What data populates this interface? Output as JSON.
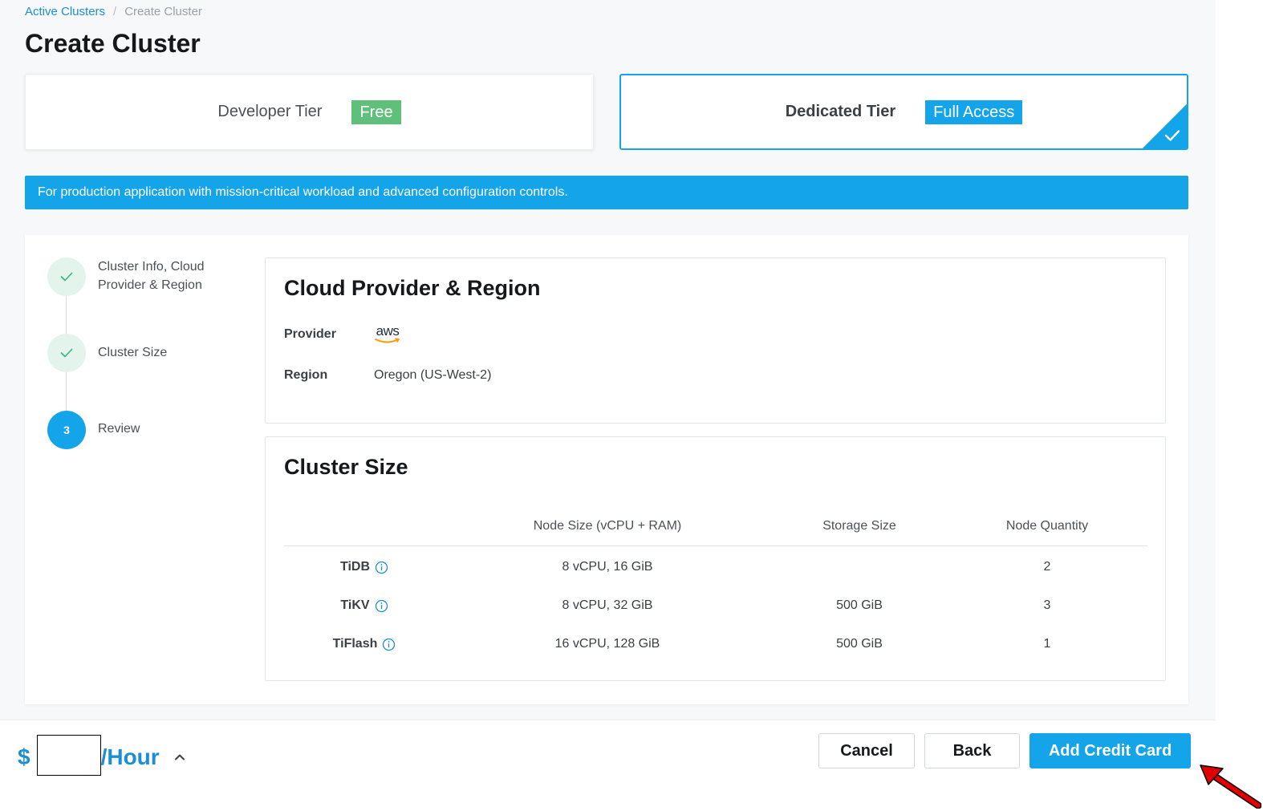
{
  "breadcrumb": {
    "parent": "Active Clusters",
    "separator": "/",
    "current": "Create Cluster"
  },
  "page_title": "Create Cluster",
  "tiers": [
    {
      "name": "Developer Tier",
      "badge": "Free",
      "badge_color": "#5ec07b",
      "selected": false
    },
    {
      "name": "Dedicated Tier",
      "badge": "Full Access",
      "badge_color": "#13a4ea",
      "selected": true
    }
  ],
  "banner_text": "For production application with mission-critical workload and advanced configuration controls.",
  "steps": [
    {
      "label": "Cluster Info, Cloud Provider & Region",
      "status": "done",
      "icon": "check-icon"
    },
    {
      "label": "Cluster Size",
      "status": "done",
      "icon": "check-icon"
    },
    {
      "label": "Review",
      "status": "active",
      "number": "3"
    }
  ],
  "cloud_section": {
    "title": "Cloud Provider & Region",
    "provider_label": "Provider",
    "provider_logo_text": "aws",
    "region_label": "Region",
    "region_value": "Oregon (US-West-2)"
  },
  "size_section": {
    "title": "Cluster Size",
    "columns": [
      "",
      "Node Size (vCPU + RAM)",
      "Storage Size",
      "Node Quantity"
    ],
    "rows": [
      {
        "component": "TiDB",
        "node_size": "8 vCPU, 16 GiB",
        "storage": "",
        "quantity": "2"
      },
      {
        "component": "TiKV",
        "node_size": "8 vCPU, 32 GiB",
        "storage": "500 GiB",
        "quantity": "3"
      },
      {
        "component": "TiFlash",
        "node_size": "16 vCPU, 128 GiB",
        "storage": "500 GiB",
        "quantity": "1"
      }
    ]
  },
  "footer": {
    "price_symbol": "$",
    "price_unit": "/Hour",
    "cancel_label": "Cancel",
    "back_label": "Back",
    "primary_label": "Add Credit Card"
  },
  "colors": {
    "accent": "#13a4ea",
    "link": "#1b8ed4",
    "success": "#5ec07b",
    "annotation_arrow": "#e00000"
  }
}
